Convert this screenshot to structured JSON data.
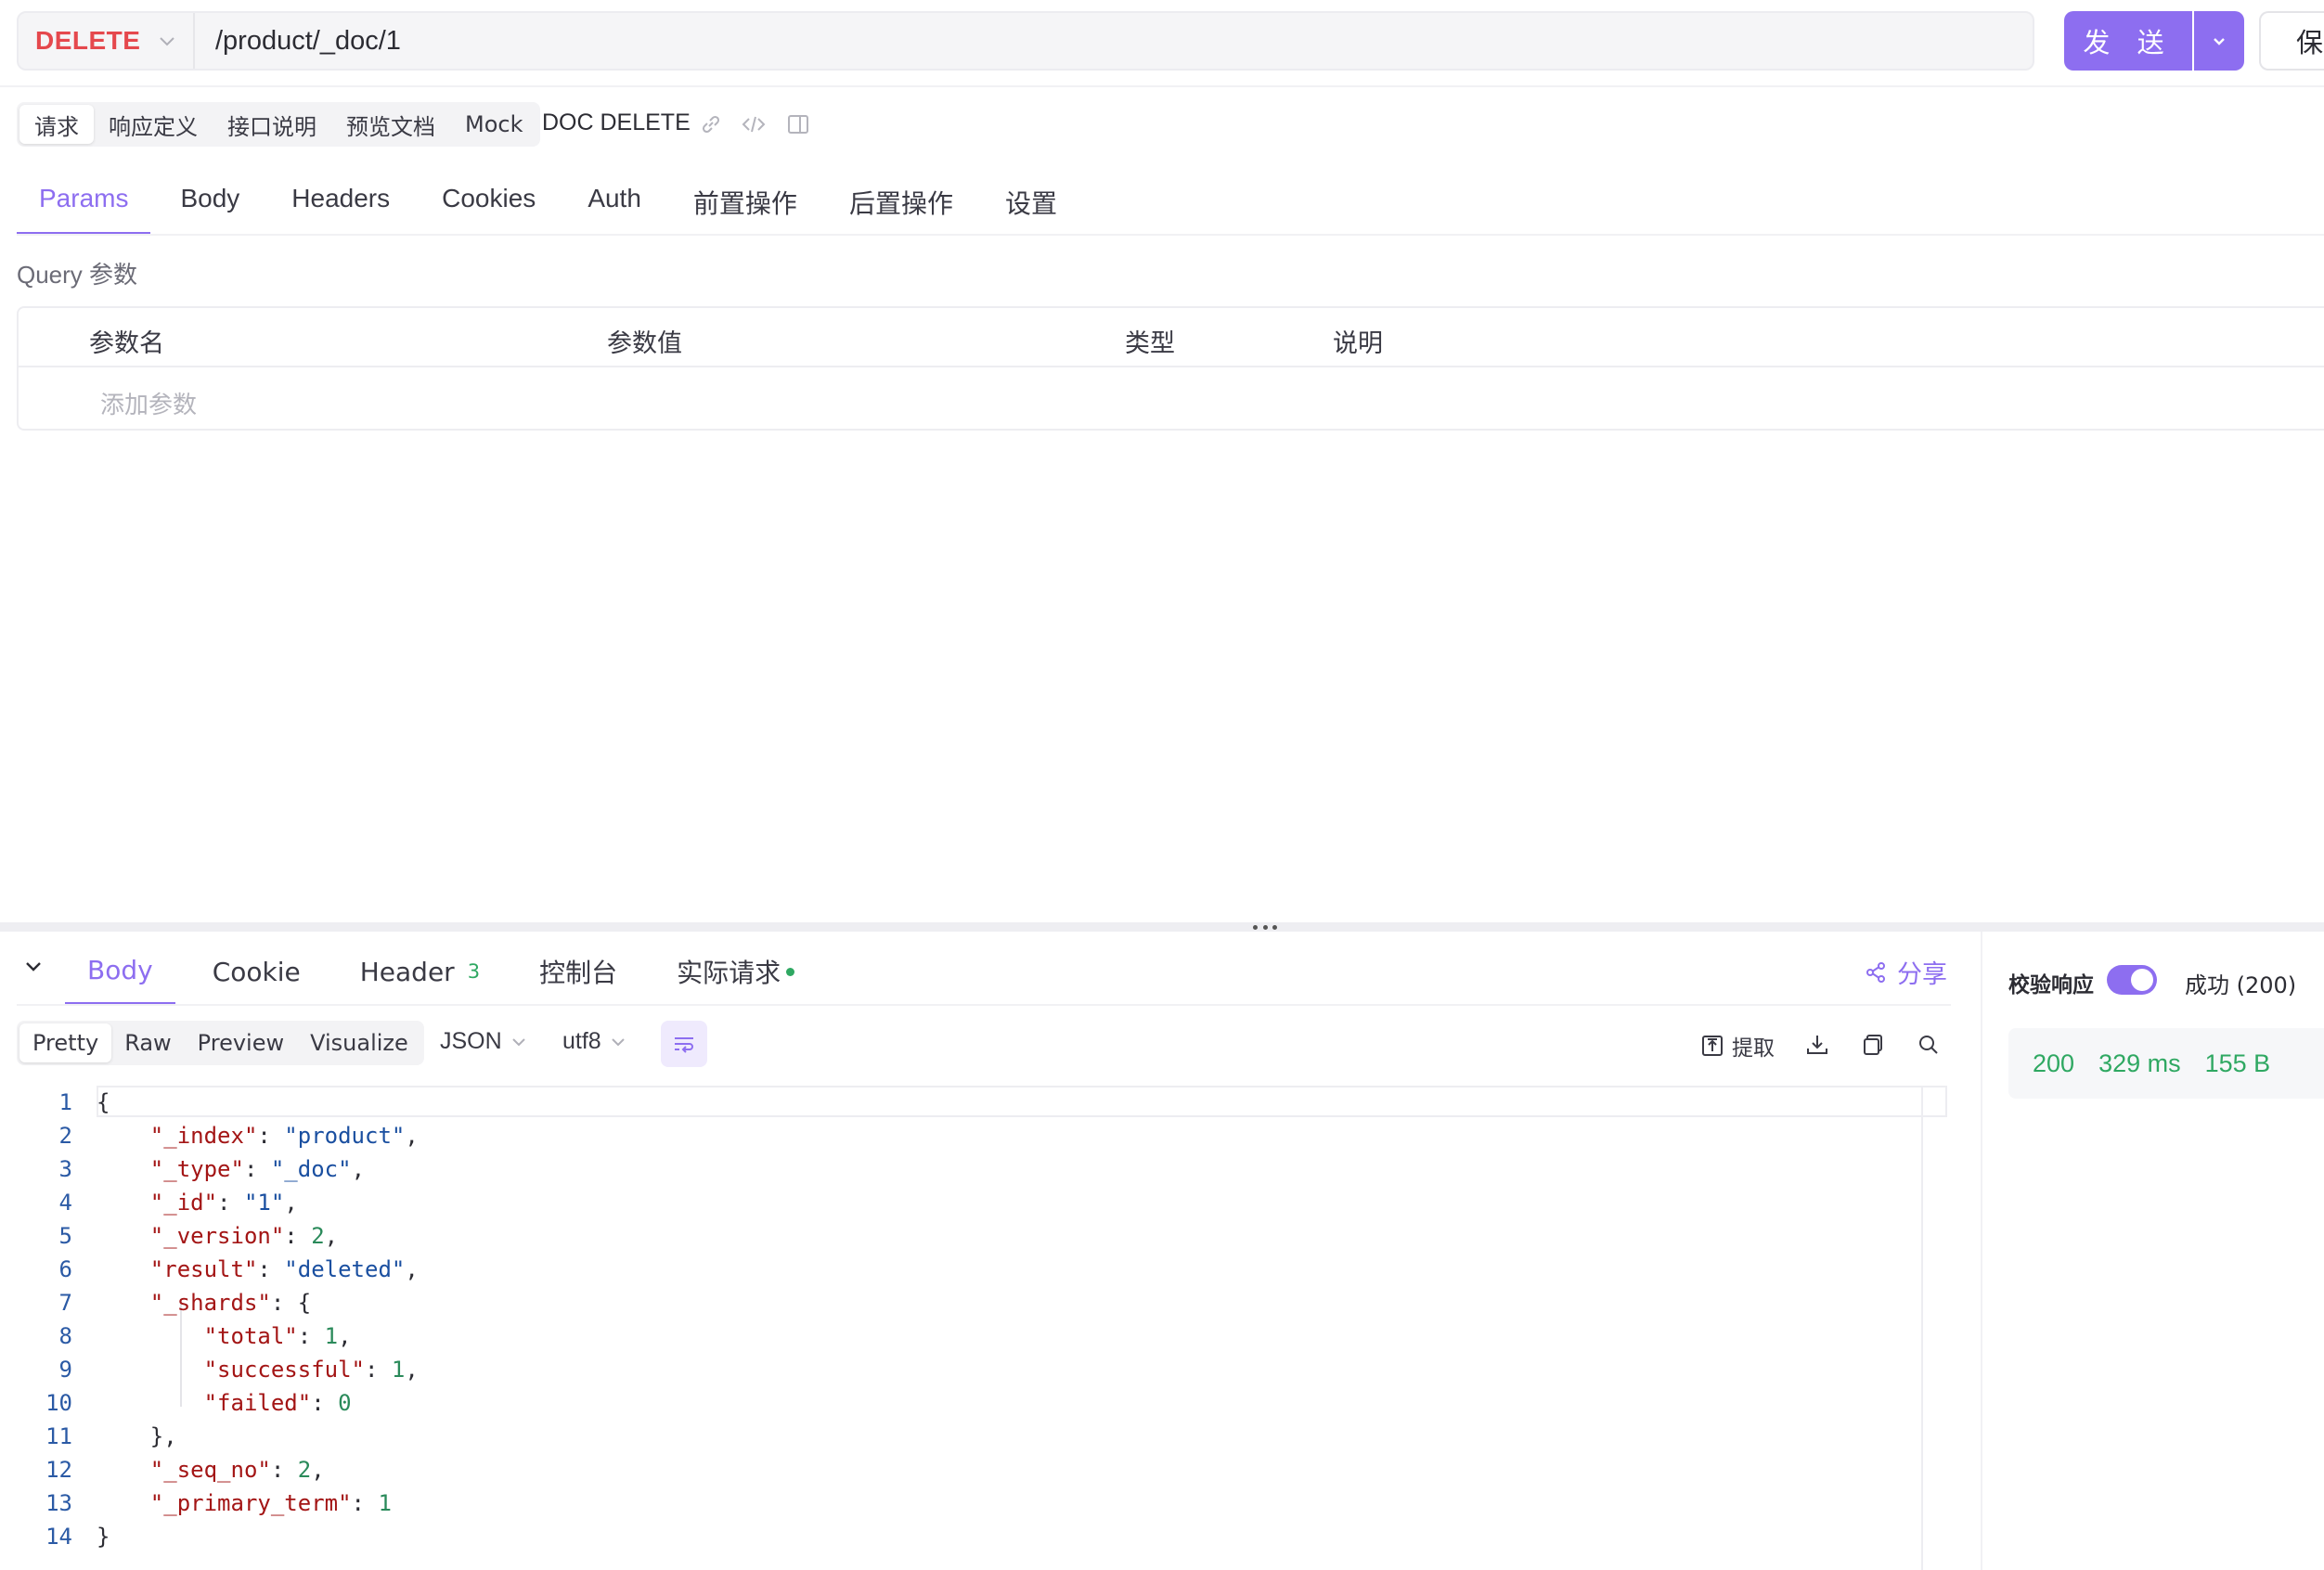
{
  "request": {
    "method": "DELETE",
    "url": "/product/_doc/1",
    "send_label": "发 送",
    "save_label": "保"
  },
  "subtabs": [
    "请求",
    "响应定义",
    "接口说明",
    "预览文档",
    "Mock"
  ],
  "doc_title": "DOC DELETE",
  "param_tabs": [
    "Params",
    "Body",
    "Headers",
    "Cookies",
    "Auth",
    "前置操作",
    "后置操作",
    "设置"
  ],
  "query": {
    "title": "Query 参数",
    "columns": [
      "参数名",
      "参数值",
      "类型",
      "说明"
    ],
    "add_placeholder": "添加参数"
  },
  "response_tabs": {
    "body": "Body",
    "cookie": "Cookie",
    "header": "Header",
    "header_count": "3",
    "console": "控制台",
    "actual": "实际请求"
  },
  "share_label": "分享",
  "view_modes": [
    "Pretty",
    "Raw",
    "Preview",
    "Visualize"
  ],
  "format": "JSON",
  "encoding": "utf8",
  "extract_label": "提取",
  "verify_label": "校验响应",
  "status_text": "成功 (200)",
  "stats": {
    "code": "200",
    "time": "329 ms",
    "size": "155 B"
  },
  "response_lines": [
    [
      [
        "p",
        "{"
      ]
    ],
    [
      [
        "p",
        "    "
      ],
      [
        "k",
        "\"_index\""
      ],
      [
        "p",
        ": "
      ],
      [
        "s",
        "\"product\""
      ],
      [
        "p",
        ","
      ]
    ],
    [
      [
        "p",
        "    "
      ],
      [
        "k",
        "\"_type\""
      ],
      [
        "p",
        ": "
      ],
      [
        "s",
        "\"_doc\""
      ],
      [
        "p",
        ","
      ]
    ],
    [
      [
        "p",
        "    "
      ],
      [
        "k",
        "\"_id\""
      ],
      [
        "p",
        ": "
      ],
      [
        "s",
        "\"1\""
      ],
      [
        "p",
        ","
      ]
    ],
    [
      [
        "p",
        "    "
      ],
      [
        "k",
        "\"_version\""
      ],
      [
        "p",
        ": "
      ],
      [
        "n",
        "2"
      ],
      [
        "p",
        ","
      ]
    ],
    [
      [
        "p",
        "    "
      ],
      [
        "k",
        "\"result\""
      ],
      [
        "p",
        ": "
      ],
      [
        "s",
        "\"deleted\""
      ],
      [
        "p",
        ","
      ]
    ],
    [
      [
        "p",
        "    "
      ],
      [
        "k",
        "\"_shards\""
      ],
      [
        "p",
        ": {"
      ]
    ],
    [
      [
        "p",
        "        "
      ],
      [
        "k",
        "\"total\""
      ],
      [
        "p",
        ": "
      ],
      [
        "n",
        "1"
      ],
      [
        "p",
        ","
      ]
    ],
    [
      [
        "p",
        "        "
      ],
      [
        "k",
        "\"successful\""
      ],
      [
        "p",
        ": "
      ],
      [
        "n",
        "1"
      ],
      [
        "p",
        ","
      ]
    ],
    [
      [
        "p",
        "        "
      ],
      [
        "k",
        "\"failed\""
      ],
      [
        "p",
        ": "
      ],
      [
        "n",
        "0"
      ]
    ],
    [
      [
        "p",
        "    },"
      ]
    ],
    [
      [
        "p",
        "    "
      ],
      [
        "k",
        "\"_seq_no\""
      ],
      [
        "p",
        ": "
      ],
      [
        "n",
        "2"
      ],
      [
        "p",
        ","
      ]
    ],
    [
      [
        "p",
        "    "
      ],
      [
        "k",
        "\"_primary_term\""
      ],
      [
        "p",
        ": "
      ],
      [
        "n",
        "1"
      ]
    ],
    [
      [
        "p",
        "}"
      ]
    ]
  ],
  "colors": {
    "accent": "#8d6ef0",
    "method": "#e5484d",
    "success": "#2fa862"
  }
}
